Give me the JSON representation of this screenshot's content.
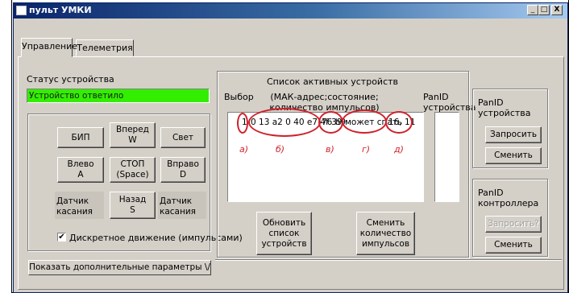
{
  "window": {
    "title": "пульт УМКИ",
    "minimize": "_",
    "maximize": "□",
    "close": "X"
  },
  "tabs": [
    {
      "label": "Управление"
    },
    {
      "label": "Телеметрия"
    }
  ],
  "status": {
    "label": "Статус устройства",
    "value": "Устройство ответило",
    "color": "#33ee00"
  },
  "controls": {
    "bip": "БИП",
    "forward": "Вперед\nW",
    "light": "Свет",
    "left": "Влево\nA",
    "stop": "СТОП\n(Space)",
    "right": "Вправо\nD",
    "sensor_left": "Датчик\nкасания",
    "back": "Назад\nS",
    "sensor_right": "Датчик\nкасания",
    "discrete_label": "Дискретное движение (импульсами)",
    "discrete_checked": true
  },
  "devices": {
    "title": "Список активных устройств",
    "col_select": "Выбор",
    "col_info": "(МАК-адрес;состояние;\nколичество импульсов)",
    "col_panid": "PanID\nустройства",
    "row": {
      "index": "1",
      "mac": "0 13 a2 0 40 e7 4f 39",
      "addr": "76 b9",
      "state": "может спать",
      "impulses": "16, 11"
    },
    "annotations": [
      "а)",
      "б)",
      "в)",
      "г)",
      "д)"
    ],
    "refresh_button": "Обновить\nсписок\nустройств",
    "change_impulses_button": "Сменить\nколичество\nимпульсов"
  },
  "panid_device": {
    "label": "PanID\nустройства",
    "request": "Запросить",
    "change": "Сменить"
  },
  "panid_controller": {
    "label": "PanID\nконтроллера",
    "request": "Запросить?",
    "change": "Сменить"
  },
  "footer": {
    "more_params": "Показать дополнительные параметры \\/"
  },
  "colors": {
    "annotation_red": "#d0202a",
    "status_green": "#33ee00",
    "title_blue": "#0a246a"
  }
}
